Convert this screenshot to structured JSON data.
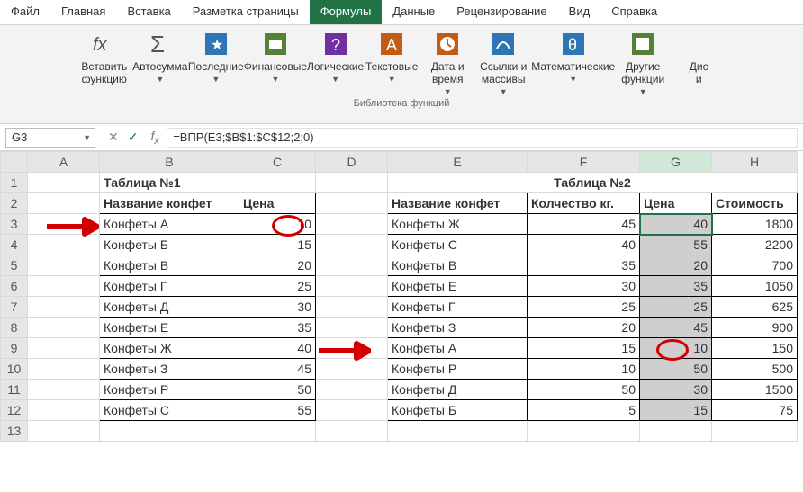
{
  "menu": {
    "items": [
      "Файл",
      "Главная",
      "Вставка",
      "Разметка страницы",
      "Формулы",
      "Данные",
      "Рецензирование",
      "Вид",
      "Справка"
    ],
    "active": 4
  },
  "ribbon": {
    "buttons": [
      {
        "label": "Вставить\nфункцию"
      },
      {
        "label": "Автосумма",
        "dd": true
      },
      {
        "label": "Последние",
        "dd": true
      },
      {
        "label": "Финансовые",
        "dd": true
      },
      {
        "label": "Логические",
        "dd": true
      },
      {
        "label": "Текстовые",
        "dd": true
      },
      {
        "label": "Дата и\nвремя",
        "dd": true
      },
      {
        "label": "Ссылки и\nмассивы",
        "dd": true
      },
      {
        "label": "Математические",
        "dd": true
      },
      {
        "label": "Другие\nфункции",
        "dd": true
      },
      {
        "label": "Дис\nи"
      }
    ],
    "group_label": "Библиотека функций"
  },
  "namebox": "G3",
  "formula": "=ВПР(E3;$B$1:$C$12;2;0)",
  "columns": [
    "A",
    "B",
    "C",
    "D",
    "E",
    "F",
    "G",
    "H"
  ],
  "titles": {
    "t1": "Таблица №1",
    "t2": "Таблица №2"
  },
  "headers1": {
    "name": "Название конфет",
    "price": "Цена"
  },
  "headers2": {
    "name": "Название конфет",
    "qty": "Колчество кг.",
    "price": "Цена",
    "cost": "Стоимость"
  },
  "table1": [
    {
      "name": "Конфеты А",
      "price": 10
    },
    {
      "name": "Конфеты Б",
      "price": 15
    },
    {
      "name": "Конфеты В",
      "price": 20
    },
    {
      "name": "Конфеты Г",
      "price": 25
    },
    {
      "name": "Конфеты Д",
      "price": 30
    },
    {
      "name": "Конфеты Е",
      "price": 35
    },
    {
      "name": "Конфеты Ж",
      "price": 40
    },
    {
      "name": "Конфеты З",
      "price": 45
    },
    {
      "name": "Конфеты Р",
      "price": 50
    },
    {
      "name": "Конфеты С",
      "price": 55
    }
  ],
  "table2": [
    {
      "name": "Конфеты Ж",
      "qty": 45,
      "price": 40,
      "cost": 1800
    },
    {
      "name": "Конфеты С",
      "qty": 40,
      "price": 55,
      "cost": 2200
    },
    {
      "name": "Конфеты В",
      "qty": 35,
      "price": 20,
      "cost": 700
    },
    {
      "name": "Конфеты Е",
      "qty": 30,
      "price": 35,
      "cost": 1050
    },
    {
      "name": "Конфеты Г",
      "qty": 25,
      "price": 25,
      "cost": 625
    },
    {
      "name": "Конфеты З",
      "qty": 20,
      "price": 45,
      "cost": 900
    },
    {
      "name": "Конфеты А",
      "qty": 15,
      "price": 10,
      "cost": 150
    },
    {
      "name": "Конфеты Р",
      "qty": 10,
      "price": 50,
      "cost": 500
    },
    {
      "name": "Конфеты Д",
      "qty": 50,
      "price": 30,
      "cost": 1500
    },
    {
      "name": "Конфеты Б",
      "qty": 5,
      "price": 15,
      "cost": 75
    }
  ]
}
